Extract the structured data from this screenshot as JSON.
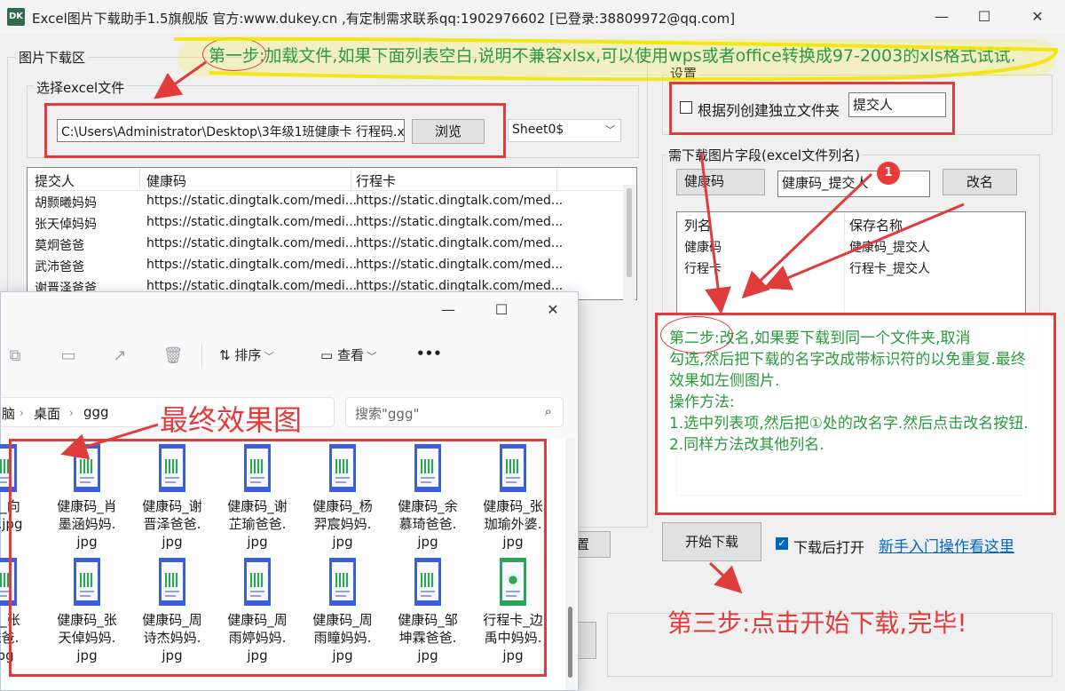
{
  "window": {
    "app_icon": "DK",
    "title": "Excel图片下载助手1.5旗舰版 官方:www.dukey.cn ,有定制需求联系qq:1902976602 [已登录:38809972@qq.com]",
    "controls": {
      "minimize": "—",
      "maximize": "☐",
      "close": "✕"
    }
  },
  "download_area": {
    "group_title": "图片下载区",
    "excel_group_title": "选择excel文件",
    "file_path": "C:\\Users\\Administrator\\Desktop\\3年级1班健康卡 行程码.x",
    "browse_label": "浏览",
    "sheet_value": "Sheet0$"
  },
  "sheet_table": {
    "columns": [
      "提交人",
      "健康码",
      "行程卡"
    ],
    "rows": [
      [
        "胡颢曦妈妈",
        "https://static.dingtalk.com/medi...",
        "https://static.dingtalk.com/med..."
      ],
      [
        "张天倬妈妈",
        "https://static.dingtalk.com/medi...",
        "https://static.dingtalk.com/med..."
      ],
      [
        "莫炯爸爸",
        "https://static.dingtalk.com/medi...",
        "https://static.dingtalk.com/med..."
      ],
      [
        "武沛爸爸",
        "https://static.dingtalk.com/medi...",
        "https://static.dingtalk.com/med..."
      ],
      [
        "谢晋泽爸爸",
        "https://static.dingtalk.com/medi...",
        "https://static.dingtalk.com/med..."
      ]
    ]
  },
  "settings": {
    "group_title": "设置",
    "folder_checkbox_label": "根据列创建独立文件夹",
    "folder_column": "提交人"
  },
  "fields": {
    "group_title": "需下载图片字段(excel文件列名)",
    "selected_column": "健康码",
    "rename_value": "健康码_提交人",
    "rename_button": "改名",
    "columns": [
      "列名",
      "保存名称"
    ],
    "rows": [
      [
        "健康码",
        "健康码_提交人"
      ],
      [
        "行程卡",
        "行程卡_提交人"
      ]
    ]
  },
  "actions": {
    "start_button": "开始下载",
    "open_after_label": "下载后打开",
    "open_after_checked": true,
    "help_link": "新手入门操作看这里",
    "partial_button": "置"
  },
  "annotations": {
    "step1": "第一步:加载文件,如果下面列表空白,说明不兼容xlsx,可以使用wps或者office转换成97-2003的xls格式试试.",
    "badge": "1",
    "step2_lines": [
      "第二步:改名,如果要下载到同一个文件夹,取消",
      "勾选,然后把下载的名字改成带标识符的以免重复.最终",
      "效果如左侧图片.",
      "操作方法:",
      "1.选中列表项,然后把①处的改名字.然后点击改名按钮.",
      "2.同样方法改其他列名."
    ],
    "step3": "第三步:点击开始下载,完毕!",
    "final_label": "最终效果图"
  },
  "explorer": {
    "controls": {
      "minimize": "—",
      "maximize": "☐",
      "close": "✕"
    },
    "toolbar": {
      "sort_label": "排序",
      "view_label": "查看",
      "more": "•••"
    },
    "breadcrumb": [
      "脑",
      "桌面",
      "ggg"
    ],
    "search_placeholder": "搜索\"ggg\"",
    "files_row1": [
      {
        "name": "码_向\n马.jpg",
        "thumb": "blue"
      },
      {
        "name": "健康码_肖\n墨涵妈妈.\njpg",
        "thumb": "blue"
      },
      {
        "name": "健康码_谢\n晋泽爸爸.\njpg",
        "thumb": "blue"
      },
      {
        "name": "健康码_谢\n芷瑜爸爸.\njpg",
        "thumb": "blue"
      },
      {
        "name": "健康码_杨\n羿宸妈妈.\njpg",
        "thumb": "blue"
      },
      {
        "name": "健康码_余\n慕琦爸爸.\njpg",
        "thumb": "blue"
      },
      {
        "name": "健康码_张\n珈瑜外婆.\njpg",
        "thumb": "blue"
      }
    ],
    "files_row2": [
      {
        "name": "码_张\n爸爸.\njpg",
        "thumb": "blue"
      },
      {
        "name": "健康码_张\n天倬妈妈.\njpg",
        "thumb": "blue"
      },
      {
        "name": "健康码_周\n诗杰妈妈.\njpg",
        "thumb": "blue"
      },
      {
        "name": "健康码_周\n雨婷妈妈.\njpg",
        "thumb": "blue"
      },
      {
        "name": "健康码_周\n雨瞳妈妈.\njpg",
        "thumb": "blue"
      },
      {
        "name": "健康码_邹\n坤霖爸爸.\njpg",
        "thumb": "blue"
      },
      {
        "name": "行程卡_边\n禹中妈妈.\njpg",
        "thumb": "green"
      }
    ]
  },
  "colors": {
    "annotation_red": "#e03c3c",
    "annotation_green": "#2a9a3e",
    "highlight_yellow": "#fff000",
    "link_blue": "#0066cc"
  }
}
